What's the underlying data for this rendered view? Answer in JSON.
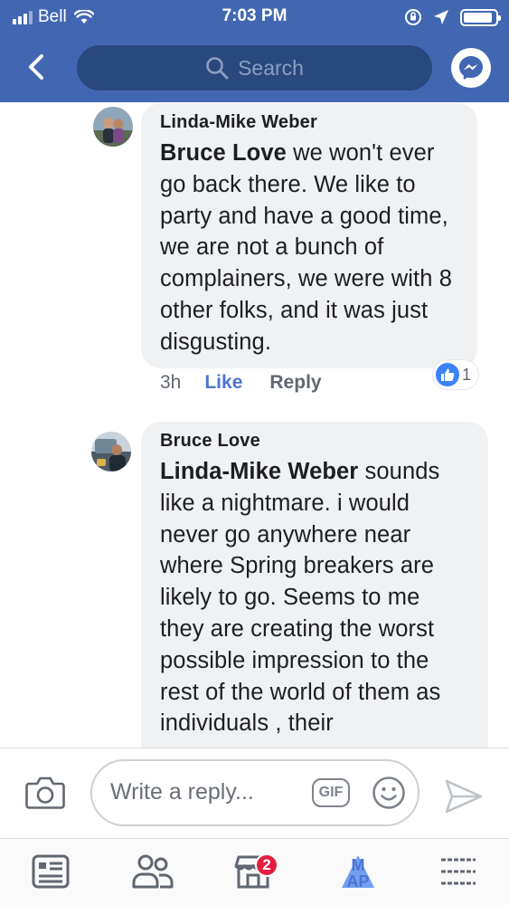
{
  "status_bar": {
    "carrier": "Bell",
    "time": "7:03 PM",
    "battery_level": 0.9
  },
  "header": {
    "search_placeholder": "Search",
    "back_icon": "chevron-left-icon",
    "messenger_icon": "messenger-icon"
  },
  "comments": [
    {
      "author": "Linda-Mike Weber",
      "mention": "Bruce Love",
      "text": " we won't ever go back there. We like to party and have a good time, we are not a bunch of complainers, we were with 8 other folks, and it was just disgusting.",
      "time": "3h",
      "like_label": "Like",
      "reply_label": "Reply",
      "reaction_count": "1"
    },
    {
      "author": "Bruce Love",
      "mention": "Linda-Mike Weber",
      "text": " sounds like a nightmare. i would never go anywhere near where Spring breakers are likely to go. Seems to me they are creating the worst possible impression to the rest of the world of them as individuals , their"
    }
  ],
  "composer": {
    "placeholder": "Write a reply...",
    "gif_label": "GIF"
  },
  "tabbar": {
    "marketplace_badge": "2",
    "app_tab_text": "M\nAP"
  },
  "colors": {
    "brand_blue": "#4267b2",
    "search_bg": "#29487d",
    "bubble_bg": "#f0f1f3",
    "link_blue": "#4a76d1",
    "badge_red": "#e41e3f"
  }
}
